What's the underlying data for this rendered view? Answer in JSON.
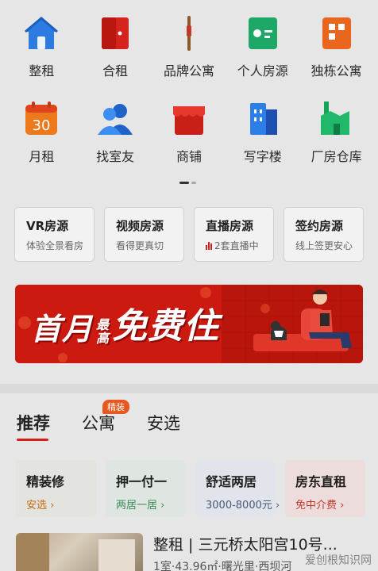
{
  "categories": {
    "row1": [
      {
        "label": "整租",
        "icon": "house-icon"
      },
      {
        "label": "合租",
        "icon": "door-icon"
      },
      {
        "label": "品牌公寓",
        "icon": "pin-icon"
      },
      {
        "label": "个人房源",
        "icon": "id-card-icon"
      },
      {
        "label": "独栋公寓",
        "icon": "building-icon"
      }
    ],
    "row2": [
      {
        "label": "月租",
        "icon": "calendar-icon",
        "calendar_number": "30"
      },
      {
        "label": "找室友",
        "icon": "people-icon"
      },
      {
        "label": "商铺",
        "icon": "shop-icon"
      },
      {
        "label": "写字楼",
        "icon": "office-tower-icon"
      },
      {
        "label": "厂房仓库",
        "icon": "factory-icon"
      }
    ]
  },
  "quick_cards": [
    {
      "title": "VR房源",
      "subtitle": "体验全景看房"
    },
    {
      "title": "视频房源",
      "subtitle": "看得更真切"
    },
    {
      "title": "直播房源",
      "subtitle": "2套直播中"
    },
    {
      "title": "签约房源",
      "subtitle": "线上签更安心"
    }
  ],
  "banner": {
    "text_first": "首月",
    "text_small_top": "最",
    "text_small_bottom": "高",
    "text_main": "免费住"
  },
  "tabs": [
    {
      "label": "推荐",
      "badge": ""
    },
    {
      "label": "公寓",
      "badge": "精装"
    },
    {
      "label": "安选",
      "badge": ""
    }
  ],
  "features": [
    {
      "title": "精装修",
      "subtitle": "安选 ›",
      "bg": "#e3e3df",
      "sub_color": "#c46a12"
    },
    {
      "title": "押一付一",
      "subtitle": "两居一居 ›",
      "bg": "#dfe5e1",
      "sub_color": "#3d8c5a"
    },
    {
      "title": "舒适两居",
      "subtitle": "3000-8000元 ›",
      "bg": "#e1e4ea",
      "sub_color": "#4b5a78"
    },
    {
      "title": "房东直租",
      "subtitle": "免中介费 ›",
      "bg": "#ecdcdc",
      "sub_color": "#c23a2a"
    }
  ],
  "listing": {
    "title": "整租 | 三元桥太阳宫10号...",
    "meta": "1室·43.96㎡·曙光里·西坝河"
  },
  "watermark": "爱创根知识网"
}
